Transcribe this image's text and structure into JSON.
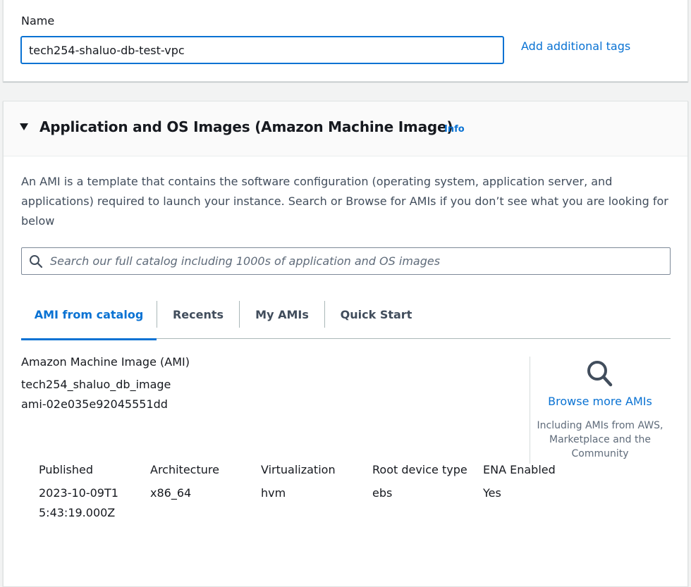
{
  "name_section": {
    "label": "Name",
    "value": "tech254-shaluo-db-test-vpc",
    "add_tags_label": "Add additional tags"
  },
  "ami_section": {
    "title": "Application and OS Images (Amazon Machine Image)",
    "info_label": "Info",
    "description": "An AMI is a template that contains the software configuration (operating system, application server, and applications) required to launch your instance. Search or Browse for AMIs if you don’t see what you are looking for below",
    "search_placeholder": "Search our full catalog including 1000s of application and OS images",
    "tabs": [
      {
        "label": "AMI from catalog",
        "active": true
      },
      {
        "label": "Recents",
        "active": false
      },
      {
        "label": "My AMIs",
        "active": false
      },
      {
        "label": "Quick Start",
        "active": false
      }
    ],
    "selected_ami": {
      "label": "Amazon Machine Image (AMI)",
      "name": "tech254_shaluo_db_image",
      "id": "ami-02e035e92045551dd"
    },
    "browse": {
      "link_label": "Browse more AMIs",
      "note": "Including AMIs from AWS, Marketplace and the Community"
    },
    "details": [
      {
        "label": "Published",
        "value": "2023-10-09T15:43:19.000Z"
      },
      {
        "label": "Architecture",
        "value": "x86_64"
      },
      {
        "label": "Virtualization",
        "value": "hvm"
      },
      {
        "label": "Root device type",
        "value": "ebs"
      },
      {
        "label": "ENA Enabled",
        "value": "Yes"
      }
    ]
  },
  "colors": {
    "accent": "#0972d3",
    "text": "#16191f",
    "secondary_text": "#414d5c",
    "muted_text": "#5f6b7a",
    "page_background": "#f2f3f3"
  },
  "icons": [
    "caret-down-icon",
    "search-icon",
    "magnifier-icon"
  ]
}
